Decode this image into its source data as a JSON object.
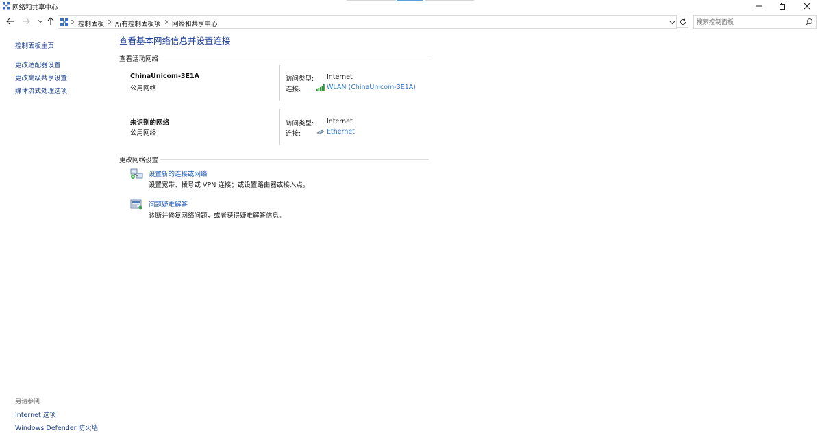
{
  "window": {
    "title": "网络和共享中心",
    "icon": "network-sharing-icon"
  },
  "address": {
    "crumbs": [
      "控制面板",
      "所有控制面板项",
      "网络和共享中心"
    ],
    "search_placeholder": "搜索控制面板"
  },
  "sidebar": {
    "home": "控制面板主页",
    "items": [
      {
        "label": "更改适配器设置"
      },
      {
        "label": "更改高级共享设置"
      },
      {
        "label": "媒体流式处理选项"
      }
    ],
    "see_also_heading": "另请参阅",
    "see_also": [
      {
        "label": "Internet 选项"
      },
      {
        "label": "Windows Defender 防火墙"
      }
    ]
  },
  "main": {
    "title": "查看基本网络信息并设置连接",
    "active_networks_heading": "查看活动网络",
    "networks": [
      {
        "name": "ChinaUnicom-3E1A",
        "type": "公用网络",
        "access_label": "访问类型:",
        "access_value": "Internet",
        "connection_label": "连接:",
        "connection_value": "WLAN (ChinaUnicom-3E1A)",
        "connection_icon": "wifi-signal-icon"
      },
      {
        "name": "未识别的网络",
        "type": "公用网络",
        "access_label": "访问类型:",
        "access_value": "Internet",
        "connection_label": "连接:",
        "connection_value": "Ethernet",
        "connection_icon": "ethernet-icon"
      }
    ],
    "change_settings_heading": "更改网络设置",
    "tasks": [
      {
        "link": "设置新的连接或网络",
        "description": "设置宽带、拨号或 VPN 连接；或设置路由器或接入点。",
        "icon": "new-connection-icon"
      },
      {
        "link": "问题疑难解答",
        "description": "诊断并修复网络问题，或者获得疑难解答信息。",
        "icon": "troubleshoot-icon"
      }
    ]
  },
  "colors": {
    "title_blue": "#1e3f9a",
    "link_blue": "#2e74c9",
    "sidebar_link": "#1a3e8a"
  }
}
